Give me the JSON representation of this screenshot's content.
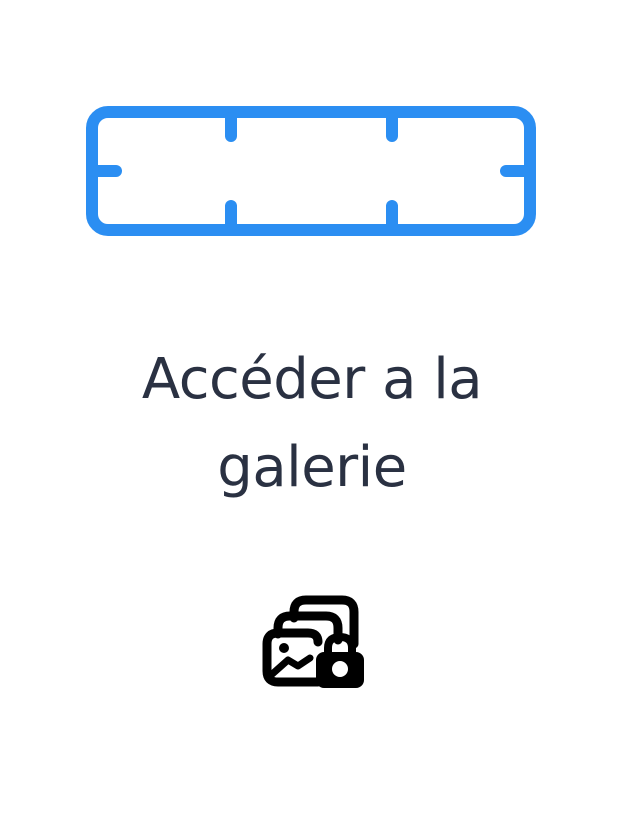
{
  "colors": {
    "accent": "#2b8ef2",
    "title_text": "#2a3142",
    "icon": "#000000",
    "background": "#ffffff"
  },
  "header_graphic": {
    "icon": "viewfinder-frame-icon"
  },
  "title": {
    "line1": "Accéder a la",
    "line2": "galerie"
  },
  "gallery_button": {
    "icon": "gallery-lock-icon"
  }
}
